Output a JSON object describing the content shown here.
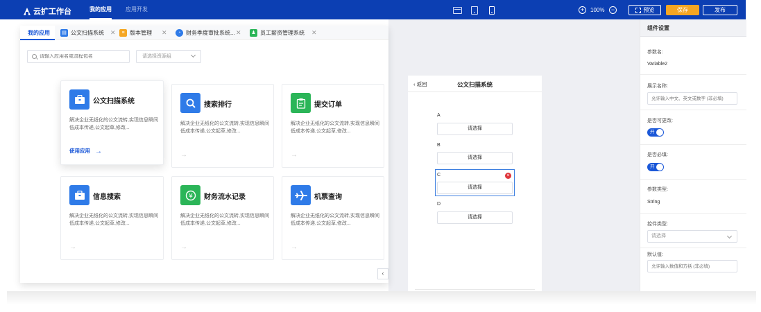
{
  "topbar": {
    "app_name": "云扩工作台",
    "nav": [
      "我的应用",
      "应用开发"
    ],
    "zoom": "100%",
    "zoom_in": "+",
    "zoom_out": "−",
    "preview_label": "预览",
    "save_label": "保存",
    "publish_label": "发布"
  },
  "tabs": [
    {
      "label": "我的应用"
    },
    {
      "label": "公文扫描系统",
      "icon_color": "#2f7be8"
    },
    {
      "label": "版本管理",
      "icon_color": "#f5a623"
    },
    {
      "label": "财务季度审批系统...",
      "icon_color": "#2f7be8"
    },
    {
      "label": "员工薪资管理系统",
      "icon_color": "#2bb558"
    }
  ],
  "search": {
    "placeholder": "请输入应用名或流程包名",
    "group_placeholder": "请选择资源组"
  },
  "cards": [
    {
      "title": "公文扫描系统",
      "desc": "解决企业无纸化的公文流转,实现信息瞬间低成本传递,公文起草,修改...",
      "action": "使用应用",
      "icon": "briefcase-icon",
      "color": "#2f7be8"
    },
    {
      "title": "搜索排行",
      "desc": "解决企业无纸化的公文流转,实现信息瞬间低成本传递,公文起草,修改...",
      "icon": "magnifier-icon",
      "color": "#2f7be8"
    },
    {
      "title": "提交订单",
      "desc": "解决企业无纸化的公文流转,实现信息瞬间低成本传递,公文起草,修改...",
      "icon": "clipboard-icon",
      "color": "#2bb558"
    },
    {
      "title": "信息搜索",
      "desc": "解决企业无纸化的公文流转,实现信息瞬间低成本传递,公文起草,修改...",
      "icon": "briefcase-icon",
      "color": "#2f7be8"
    },
    {
      "title": "财务流水记录",
      "desc": "解决企业无纸化的公文流转,实现信息瞬间低成本传递,公文起草,修改...",
      "icon": "yen-icon",
      "color": "#2bb558"
    },
    {
      "title": "机票查询",
      "desc": "解决企业无纸化的公文流转,实现信息瞬间低成本传递,公文起草,修改...",
      "icon": "airplane-icon",
      "color": "#2f7be8"
    }
  ],
  "phone": {
    "back": "返回",
    "title": "公文扫描系统",
    "fields": [
      {
        "label": "A",
        "value": "请选择"
      },
      {
        "label": "B",
        "value": "请选择"
      },
      {
        "label": "C",
        "value": "请选择"
      },
      {
        "label": "D",
        "value": "请选择"
      }
    ]
  },
  "settings": {
    "header": "组件设置",
    "param_name_label": "参数名:",
    "param_name_value": "Variable2",
    "display_name_label": "展示名称:",
    "display_name_placeholder": "允许输入中文、英文或数字 (非必填)",
    "editable_label": "是否可更改:",
    "editable_toggle": "开",
    "required_label": "是否必填:",
    "required_toggle": "开",
    "param_type_label": "参数类型:",
    "param_type_value": "String",
    "control_type_label": "控件类型:",
    "control_type_placeholder": "请选择",
    "default_label": "默认值:",
    "default_placeholder": "允许输入数值和方括 (非必填)"
  }
}
